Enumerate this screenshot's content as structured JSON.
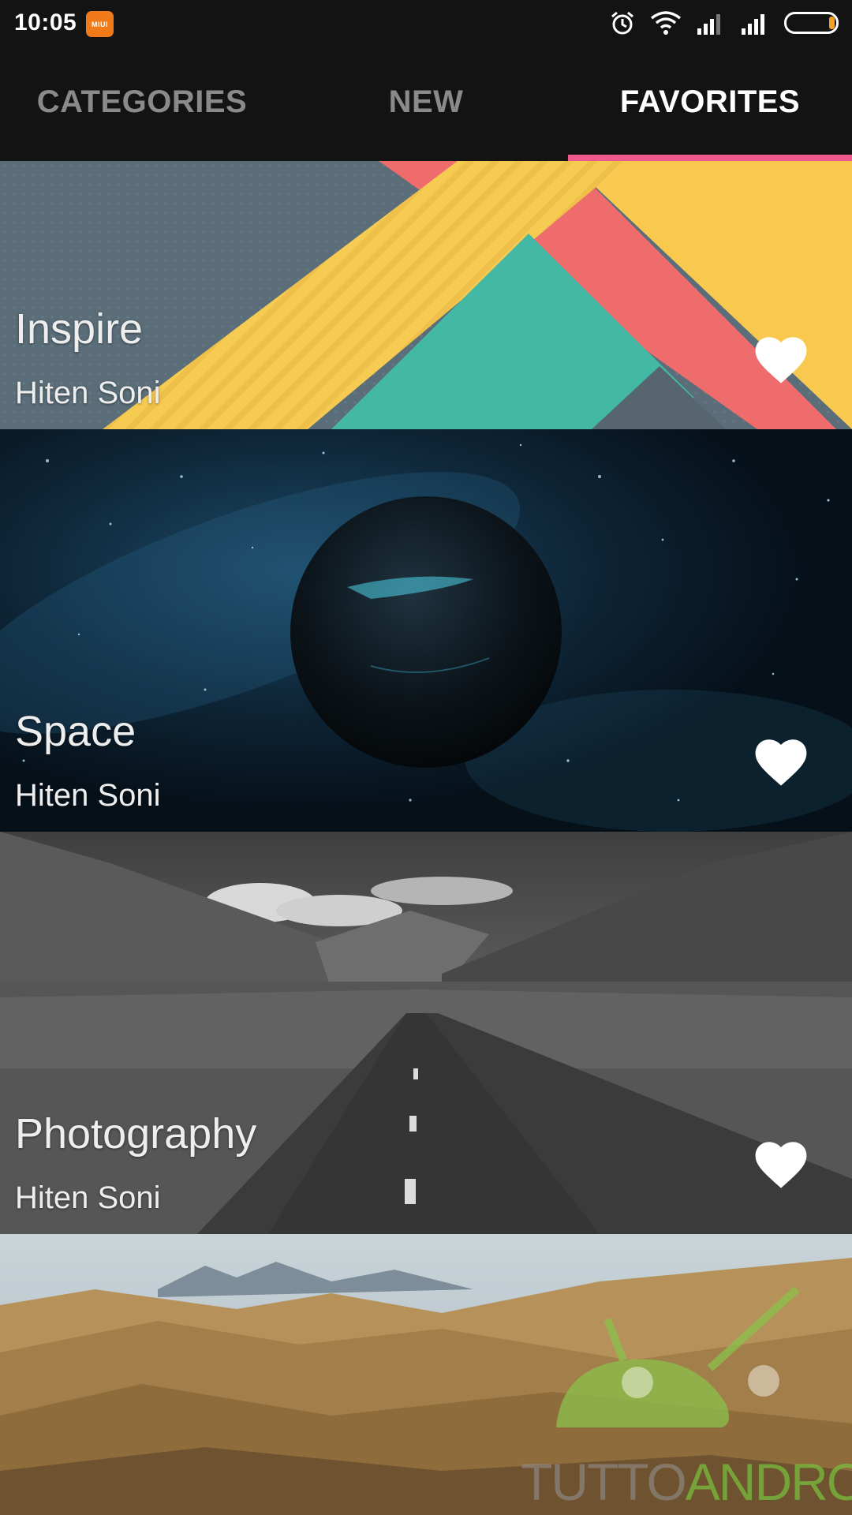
{
  "status_bar": {
    "time": "10:05",
    "miui_badge": "MIUI",
    "icons": [
      "alarm-icon",
      "wifi-icon",
      "signal-icon",
      "signal-icon",
      "battery-icon"
    ]
  },
  "tabs": [
    {
      "label": "CATEGORIES",
      "active": false
    },
    {
      "label": "NEW",
      "active": false
    },
    {
      "label": "FAVORITES",
      "active": true
    }
  ],
  "accent_color": "#ef5a8e",
  "cards": [
    {
      "title": "Inspire",
      "author": "Hiten Soni",
      "favorited": true,
      "icon": "heart-icon"
    },
    {
      "title": "Space",
      "author": "Hiten Soni",
      "favorited": true,
      "icon": "heart-icon"
    },
    {
      "title": "Photography",
      "author": "Hiten Soni",
      "favorited": true,
      "icon": "heart-icon"
    }
  ],
  "watermark": {
    "part1": "TUTTO",
    "part2": "ANDROID"
  }
}
